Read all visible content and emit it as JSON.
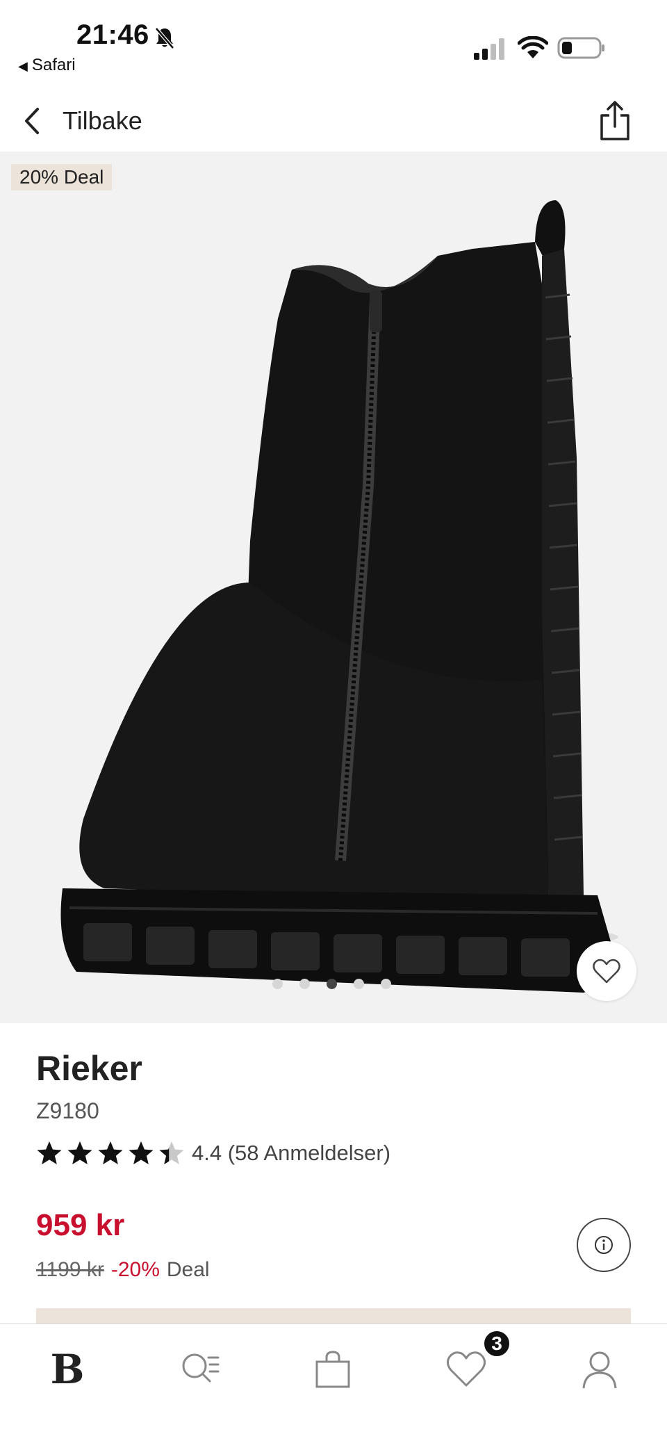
{
  "status_bar": {
    "time": "21:46",
    "back_app": "Safari",
    "back_glyph": "◀"
  },
  "nav": {
    "back_label": "Tilbake"
  },
  "gallery": {
    "deal_badge": "20% Deal",
    "image_count": 5,
    "active_image_index": 2
  },
  "product": {
    "brand": "Rieker",
    "model": "Z9180",
    "rating_value": 4.4,
    "rating_text": "4.4 (58 Anmeldelser)",
    "price": "959 kr",
    "old_price": "1199 kr",
    "discount": "-20%",
    "deal_label": "Deal"
  },
  "tab_bar": {
    "home_glyph": "B",
    "favorites_badge": "3"
  },
  "colors": {
    "accent_red": "#c8102e",
    "beige": "#ece3da",
    "gallery_bg": "#f2f2f2"
  },
  "icons": {
    "status": [
      "bell-slash-icon",
      "signal-icon",
      "wifi-icon",
      "battery-icon"
    ],
    "nav": [
      "chevron-left-icon",
      "share-icon"
    ],
    "product": [
      "heart-icon",
      "info-icon",
      "star-icon"
    ],
    "tabs": [
      "brand-logo-icon",
      "search-list-icon",
      "shopping-bag-icon",
      "heart-icon",
      "profile-icon"
    ]
  }
}
